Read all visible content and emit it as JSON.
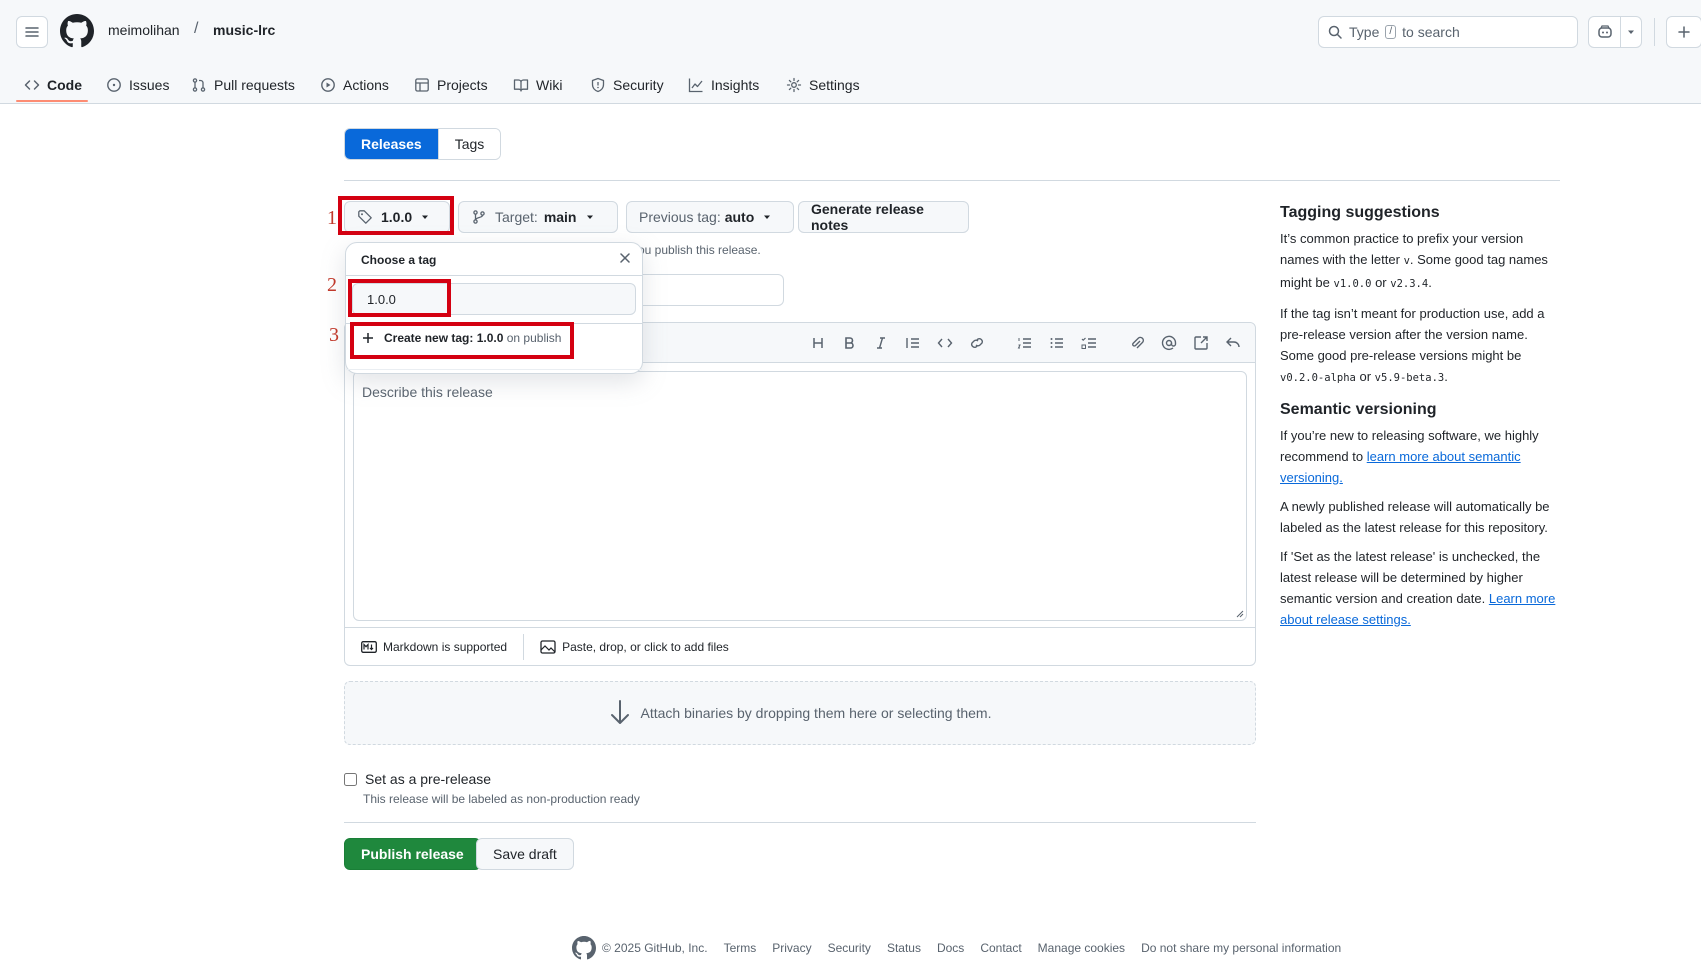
{
  "header": {
    "owner": "meimolihan",
    "separator": "/",
    "repo": "music-lrc",
    "search_prefix": "Type",
    "search_key": "/",
    "search_suffix": "to search"
  },
  "nav": {
    "code": "Code",
    "issues": "Issues",
    "pulls": "Pull requests",
    "actions": "Actions",
    "projects": "Projects",
    "wiki": "Wiki",
    "security": "Security",
    "insights": "Insights",
    "settings": "Settings"
  },
  "tabs": {
    "releases": "Releases",
    "tags": "Tags"
  },
  "toolbar": {
    "tag_value": "1.0.0",
    "target_label": "Target:",
    "target_value": "main",
    "previous_label": "Previous tag:",
    "previous_value": "auto",
    "generate_label": "Generate release notes"
  },
  "annotations": {
    "n1": "1",
    "n2": "2",
    "n3": "3"
  },
  "dropdown": {
    "title": "Choose a tag",
    "input_value": "1.0.0",
    "create_prefix": "Create new tag: 1.0.0",
    "create_suffix": "on publish"
  },
  "hint_text": "ou publish this release.",
  "editor": {
    "placeholder": "Describe this release",
    "markdown_label": "Markdown is supported",
    "files_label": "Paste, drop, or click to add files"
  },
  "attach_text": "Attach binaries by dropping them here or selecting them.",
  "prerelease": {
    "label": "Set as a pre-release",
    "sub": "This release will be labeled as non-production ready"
  },
  "buttons": {
    "publish": "Publish release",
    "draft": "Save draft"
  },
  "sidebar": {
    "tag_title": "Tagging suggestions",
    "tag_p1a": "It’s common practice to prefix your version names with the letter",
    "tag_p1_code1": "v",
    "tag_p1b": ". Some good tag names might be",
    "tag_p1_code2": "v1.0.0",
    "tag_p1c": "or",
    "tag_p1_code3": "v2.3.4",
    "tag_p1d": ".",
    "tag_p2a": "If the tag isn’t meant for production use, add a pre-release version after the version name. Some good pre-release versions might be",
    "tag_p2_code1": "v0.2.0-alpha",
    "tag_p2b": "or",
    "tag_p2_code2": "v5.9-beta.3",
    "tag_p2c": ".",
    "semver_title": "Semantic versioning",
    "semver_p1a": "If you’re new to releasing software, we highly recommend to",
    "semver_link": "learn more about semantic versioning.",
    "semver_p2": "A newly published release will automatically be labeled as the latest release for this repository.",
    "semver_p3a": "If 'Set as the latest release' is unchecked, the latest release will be determined by higher semantic version and creation date.",
    "semver_link2": "Learn more about release settings."
  },
  "footer": {
    "copyright": "© 2025 GitHub, Inc.",
    "links": [
      "Terms",
      "Privacy",
      "Security",
      "Status",
      "Docs",
      "Contact",
      "Manage cookies",
      "Do not share my personal information"
    ]
  }
}
